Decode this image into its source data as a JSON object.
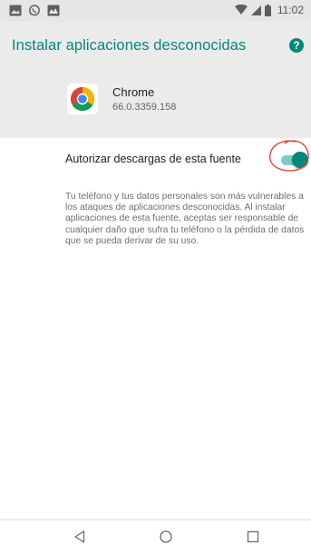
{
  "status_bar": {
    "time": "11:02",
    "left_icons": [
      "image-icon",
      "whatsapp-icon",
      "gallery-icon"
    ],
    "right_icons": [
      "wifi-icon",
      "signal-icon",
      "battery-icon"
    ]
  },
  "header": {
    "title": "Instalar aplicaciones desconocidas",
    "help_icon": "help-icon"
  },
  "app": {
    "name": "Chrome",
    "version": "66.0.3359.158",
    "icon": "chrome-icon"
  },
  "setting": {
    "label": "Autorizar descargas de esta fuente",
    "enabled": true
  },
  "description": "Tu teléfono y tus datos personales son más vulnerables a los ataques de aplicaciones desconocidas. Al instalar aplicaciones de esta fuente, aceptas ser responsable de cualquier daño que sufra tu teléfono o la pérdida de datos que se pueda derivar de su uso.",
  "nav": {
    "buttons": [
      "back-icon",
      "home-icon",
      "recents-icon"
    ]
  },
  "colors": {
    "accent": "#00897b",
    "track": "#80cbc4",
    "header_bg": "#ebebeb",
    "annotation": "#e53935"
  }
}
